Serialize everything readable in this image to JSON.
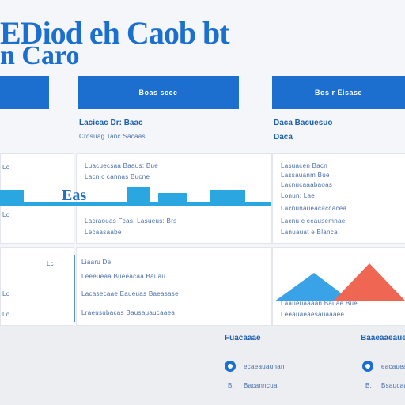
{
  "title": {
    "line1": "EDiod eh Caob bt",
    "line2": "n Caro"
  },
  "colors": {
    "brand_blue": "#1d6fcf",
    "strip_cyan": "#2aa7e0",
    "triangle_blue": "#3aa3e8",
    "triangle_red": "#ef6652"
  },
  "header_bars": [
    {
      "label": ""
    },
    {
      "label": "Boas scce"
    },
    {
      "label": "Bos r Eisase"
    }
  ],
  "col_headers": {
    "col2": {
      "title": "Lacicac Dr: Baac",
      "sub": "Crosuag Tanc Sacaas"
    },
    "col3": {
      "title": "Daca Bacuesuo",
      "sub": "Daca"
    }
  },
  "panel_left": {
    "rows": [
      "Lc",
      "Lc"
    ]
  },
  "panel_mid": {
    "row1": "Luacuecsaa Baaus: Bue",
    "row2": "Lacn c cannas Bucne",
    "strip_label": "Eas",
    "row3": "Lacraouas Fcas: Lasueus: Brs",
    "row4": "Lecaasaabe"
  },
  "panel_right": {
    "rows": [
      "Lasuacen Bacn",
      "Lassauanm Bue",
      "Lacnucaaabaoas",
      "Lonun: Lae",
      "Lacnunaueacaccacea",
      "Lacnu c ecausemnae",
      "Lanuauat e Blanca"
    ]
  },
  "lower_left": {
    "rows": [
      "Lc",
      "Lc",
      "Lc"
    ]
  },
  "lower_mid": {
    "rows": [
      "Liaaru De",
      "Leeeueaa Bueeacaa Bauau",
      "Lacasecaae Eaueuas Baeasase",
      "Lraeusubacas Bausauaucaaea"
    ]
  },
  "lower_right": {
    "rows": [
      "Laaueuaaaan Bauae Bue",
      "Leeauaeaesauaaaee"
    ]
  },
  "bottom": {
    "col_a": {
      "title": "Fuacaaae",
      "items": [
        "ecaeauaunan",
        "Bacanncua"
      ]
    },
    "col_b": {
      "title": "Baaeaaeaue",
      "items": [
        "eacaueanr",
        "Bsaucaaae"
      ]
    }
  }
}
